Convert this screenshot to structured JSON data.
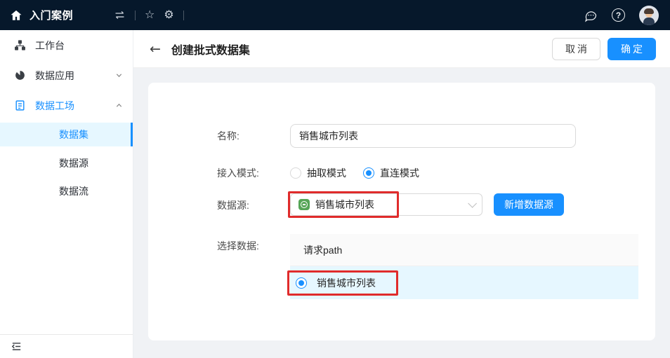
{
  "colors": {
    "topbar_bg": "#06182b",
    "primary_blue": "#1890ff",
    "selected_row_bg": "#e6f7ff",
    "content_bg": "#f0f2f5",
    "table_header_bg": "#fafafa",
    "annotation_red": "#e02b2b",
    "datasource_icon_green": "#56a557"
  },
  "topbar": {
    "app_title": "入门案例",
    "star_glyph": "☆",
    "gear_glyph": "⚙",
    "help_glyph": "?",
    "icons": [
      "home-icon",
      "swap-icon",
      "star-icon",
      "gear-icon",
      "chat-icon",
      "help-icon",
      "user-avatar"
    ]
  },
  "sidebar": {
    "items": [
      {
        "label": "工作台",
        "icon": "workbench-icon",
        "expandable": false,
        "active": false
      },
      {
        "label": "数据应用",
        "icon": "pie-chart-icon",
        "expandable": true,
        "expanded": false,
        "active": false
      },
      {
        "label": "数据工场",
        "icon": "list-icon",
        "expandable": true,
        "expanded": true,
        "active": true
      }
    ],
    "sub_items": [
      {
        "label": "数据集",
        "selected": true
      },
      {
        "label": "数据源",
        "selected": false
      },
      {
        "label": "数据流",
        "selected": false
      }
    ],
    "collapse_icon": "menu-fold-icon"
  },
  "page_header": {
    "back_glyph": "←",
    "title": "创建批式数据集",
    "cancel_label": "取消",
    "confirm_label": "确定"
  },
  "form": {
    "name": {
      "label": "名称:",
      "value": "销售城市列表"
    },
    "access_mode": {
      "label": "接入模式:",
      "options": [
        {
          "label": "抽取模式",
          "selected": false
        },
        {
          "label": "直连模式",
          "selected": true
        }
      ]
    },
    "datasource": {
      "label": "数据源:",
      "selected_value": "销售城市列表",
      "add_button_label": "新增数据源"
    },
    "select_data": {
      "label": "选择数据:",
      "column_header": "请求path",
      "rows": [
        {
          "label": "销售城市列表",
          "selected": true
        }
      ]
    }
  }
}
